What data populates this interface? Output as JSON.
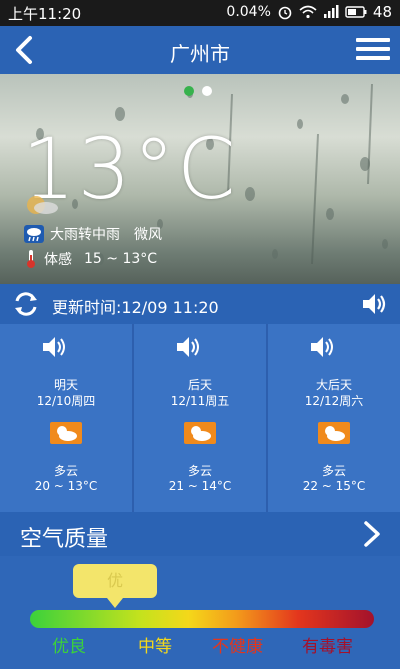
{
  "status_bar": {
    "time": "上午11:20",
    "network_speed": "0.04%",
    "battery": "48"
  },
  "header": {
    "city": "广州市"
  },
  "current": {
    "temperature": "13°C",
    "condition": "大雨转中雨",
    "wind": "微风",
    "feels_label": "体感",
    "feels_range": "15 ~ 13°C",
    "active_page_dot": 1,
    "page_dot_count": 2
  },
  "update": {
    "text": "更新时间:12/09 11:20"
  },
  "forecast": [
    {
      "day": "明天",
      "date": "12/10周四",
      "condition": "多云",
      "range": "20 ~ 13°C",
      "icon": "partly-cloudy-icon"
    },
    {
      "day": "后天",
      "date": "12/11周五",
      "condition": "多云",
      "range": "21 ~ 14°C",
      "icon": "partly-cloudy-icon"
    },
    {
      "day": "大后天",
      "date": "12/12周六",
      "condition": "多云",
      "range": "22 ~ 15°C",
      "icon": "partly-cloudy-icon"
    }
  ],
  "air_quality": {
    "title": "空气质量",
    "level": "优",
    "scale_labels": [
      "优良",
      "中等",
      "不健康",
      "有毒害"
    ],
    "scale_label_colors": [
      "#3bd13b",
      "#f4d81a",
      "#e3361d",
      "#a3122c"
    ]
  },
  "colors": {
    "title_bar": "#2b63b4",
    "forecast_bg": "#3a73c4",
    "icon_orange": "#f08a1c"
  }
}
